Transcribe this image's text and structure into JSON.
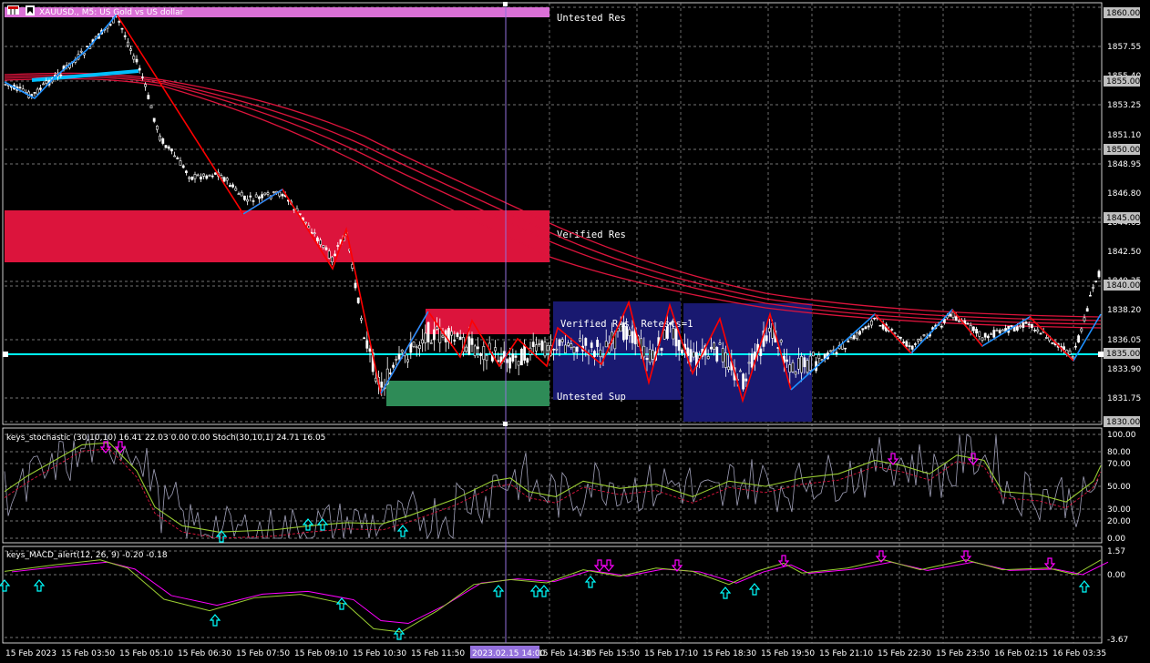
{
  "header": {
    "symbol_title": "XAUUSD., M5:  US Gold vs US dollar",
    "stoch_title": "keys_stochastic (30,10,10) 16.41 22.03 0.00 0.00 Stoch(30,10,1) 24.71 16.05",
    "macd_title": "keys_MACD_alert(12, 26, 9) -0.20 -0.18"
  },
  "zones": {
    "untested_res": "Untested Res",
    "verified_res": "Verified Res",
    "verified_res_retests": "Verified Res, Retests=1",
    "untested_sup": "Untested Sup"
  },
  "price_axis": {
    "labels": [
      "1857.55",
      "1855.40",
      "1853.25",
      "1851.10",
      "1848.95",
      "1846.80",
      "1844.65",
      "1842.50",
      "1840.35",
      "1838.20",
      "1836.05",
      "1833.90",
      "1831.75"
    ],
    "boxed": [
      "1860.00",
      "1855.00",
      "1850.00",
      "1845.00",
      "1840.00",
      "1835.00",
      "1830.00"
    ]
  },
  "stoch_axis": [
    "100.00",
    "80.00",
    "70.00",
    "50.00",
    "30.00",
    "20.00",
    "0.00"
  ],
  "macd_axis": [
    "1.57",
    "0.00",
    "-3.67"
  ],
  "time_axis": {
    "labels": [
      "15 Feb 2023",
      "15 Feb 03:50",
      "15 Feb 05:10",
      "15 Feb 06:30",
      "15 Feb 07:50",
      "15 Feb 09:10",
      "15 Feb 10:30",
      "15 Feb 11:50",
      "15 Feb 14:30",
      "15 Feb 15:50",
      "15 Feb 17:10",
      "15 Feb 18:30",
      "15 Feb 19:50",
      "15 Feb 21:10",
      "15 Feb 22:30",
      "15 Feb 23:50",
      "16 Feb 02:15",
      "16 Feb 03:35"
    ],
    "cursor": "2023.02.15 14:00"
  },
  "colors": {
    "background": "#000000",
    "resistance": "#dc143c",
    "support": "#2e8b57",
    "retest_box": "#191970",
    "untested_res_bar": "#da70d6",
    "horizontal_line": "#00ffff",
    "ma": "#dc143c",
    "zigzag_up": "#1e90ff",
    "zigzag_down": "#ff0000",
    "stoch_main": "#9acd32",
    "stoch_signal": "#dc143c",
    "macd_main": "#9acd32",
    "macd_signal": "#ff00ff",
    "buy_arrow": "#00ffff",
    "sell_arrow": "#ff00ff"
  },
  "icons": {
    "chart_icon": "chart-grid-icon",
    "ea_icon": "bookmark-icon"
  }
}
